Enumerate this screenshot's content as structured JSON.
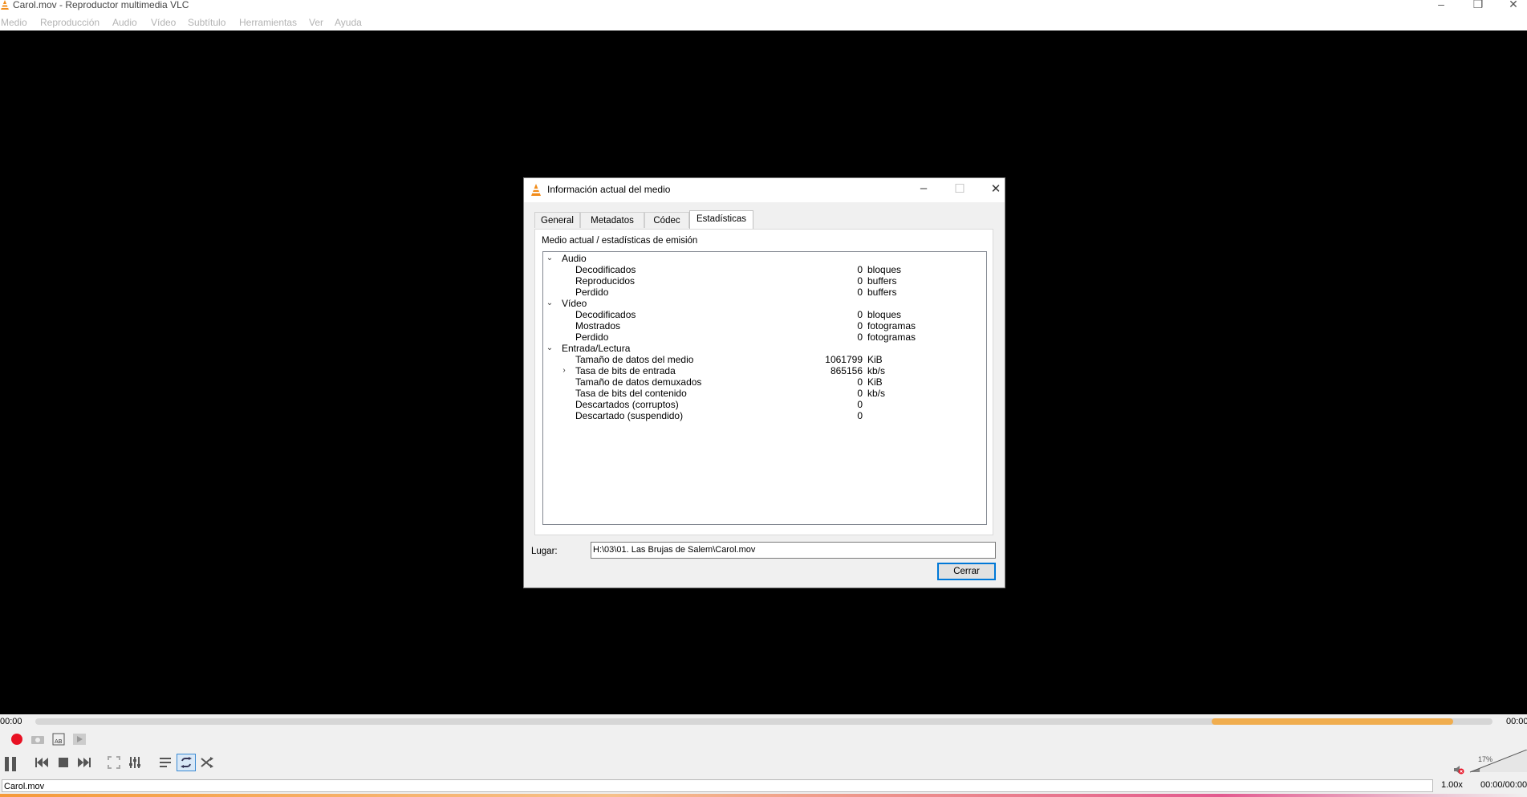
{
  "window": {
    "title": "Carol.mov - Reproductor multimedia VLC",
    "menu": [
      "Medio",
      "Reproducción",
      "Audio",
      "Vídeo",
      "Subtítulo",
      "Herramientas",
      "Ver",
      "Ayuda"
    ]
  },
  "dialog": {
    "title": "Información actual del medio",
    "tabs": [
      "General",
      "Metadatos",
      "Códec",
      "Estadísticas"
    ],
    "active_tab": "Estadísticas",
    "section_label": "Medio actual / estadísticas de emisión",
    "groups": [
      {
        "name": "Audio",
        "rows": [
          {
            "label": "Decodificados",
            "value": "0",
            "unit": "bloques"
          },
          {
            "label": "Reproducidos",
            "value": "0",
            "unit": "buffers"
          },
          {
            "label": "Perdido",
            "value": "0",
            "unit": "buffers"
          }
        ]
      },
      {
        "name": "Vídeo",
        "rows": [
          {
            "label": "Decodificados",
            "value": "0",
            "unit": "bloques"
          },
          {
            "label": "Mostrados",
            "value": "0",
            "unit": "fotogramas"
          },
          {
            "label": "Perdido",
            "value": "0",
            "unit": "fotogramas"
          }
        ]
      },
      {
        "name": "Entrada/Lectura",
        "rows": [
          {
            "label": "Tamaño de datos del medio",
            "value": "1061799",
            "unit": "KiB"
          },
          {
            "label": "Tasa de bits de entrada",
            "value": "865156",
            "unit": "kb/s",
            "expandable": true
          },
          {
            "label": "Tamaño de datos demuxados",
            "value": "0",
            "unit": "KiB"
          },
          {
            "label": "Tasa de bits del contenido",
            "value": "0",
            "unit": "kb/s"
          },
          {
            "label": "Descartados (corruptos)",
            "value": "0",
            "unit": ""
          },
          {
            "label": "Descartado (suspendido)",
            "value": "0",
            "unit": ""
          }
        ]
      }
    ],
    "location_label": "Lugar:",
    "location_value": "H:\\03\\01. Las Brujas de Salem\\Carol.mov",
    "close_label": "Cerrar"
  },
  "player": {
    "elapsed": "00:00",
    "remaining": "00:00",
    "buffered_fraction_start": 0.807,
    "buffered_fraction_end": 0.973,
    "volume_label": "17%",
    "volume_fraction": 0.17,
    "status_filename": "Carol.mov",
    "speed": "1.00x",
    "time_total": "00:00/00:00"
  },
  "colors": {
    "video_bg": "#000000",
    "buffer_bar": "#f0ad4e",
    "record": "#e81123",
    "accent": "#0078d7"
  }
}
